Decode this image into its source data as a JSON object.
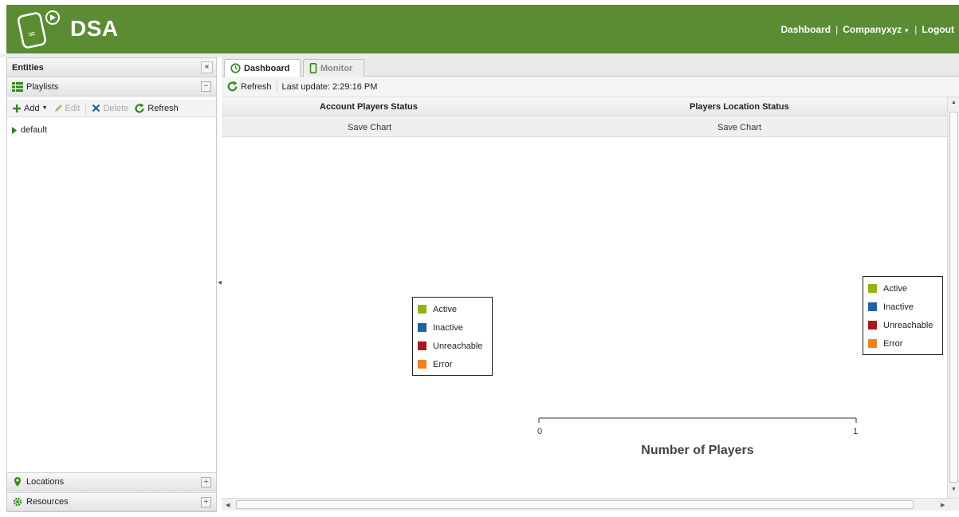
{
  "app": {
    "title": "DSA",
    "brand_color": "#5b8c34"
  },
  "header": {
    "nav_dashboard": "Dashboard",
    "separator": "|",
    "nav_company": "Companyxyz",
    "nav_logout": "Logout"
  },
  "left_panel": {
    "entities_title": "Entities",
    "collapse_glyph": "«",
    "playlists_title": "Playlists",
    "playlists_toggle": "−",
    "toolbar": {
      "add": "Add",
      "edit": "Edit",
      "delete": "Delete",
      "refresh": "Refresh"
    },
    "tree": [
      {
        "label": "default"
      }
    ],
    "locations_title": "Locations",
    "resources_title": "Resources",
    "expand_glyph": "+"
  },
  "tabs": [
    {
      "label": "Dashboard",
      "icon": "clock-icon",
      "active": true
    },
    {
      "label": "Monitor",
      "icon": "phone-icon",
      "active": false
    }
  ],
  "dashboard": {
    "refresh_label": "Refresh",
    "last_update": "Last update: 2:29:16 PM"
  },
  "charts": {
    "left_title": "Account Players Status",
    "right_title": "Players Location Status",
    "save_label": "Save Chart"
  },
  "chart_data": [
    {
      "type": "pie",
      "title": "Account Players Status",
      "legend": [
        "Active",
        "Inactive",
        "Unreachable",
        "Error"
      ],
      "legend_colors": [
        "#8fb416",
        "#1c63a6",
        "#a7181c",
        "#f48120"
      ],
      "values": []
    },
    {
      "type": "bar",
      "title": "Players Location Status",
      "xlabel": "Number of Players",
      "xlim": [
        0,
        1
      ],
      "x_ticks": [
        "0",
        "1"
      ],
      "legend": [
        "Active",
        "Inactive",
        "Unreachable",
        "Error"
      ],
      "legend_colors": [
        "#8fb416",
        "#1c63a6",
        "#a7181c",
        "#f48120"
      ],
      "series": []
    }
  ]
}
